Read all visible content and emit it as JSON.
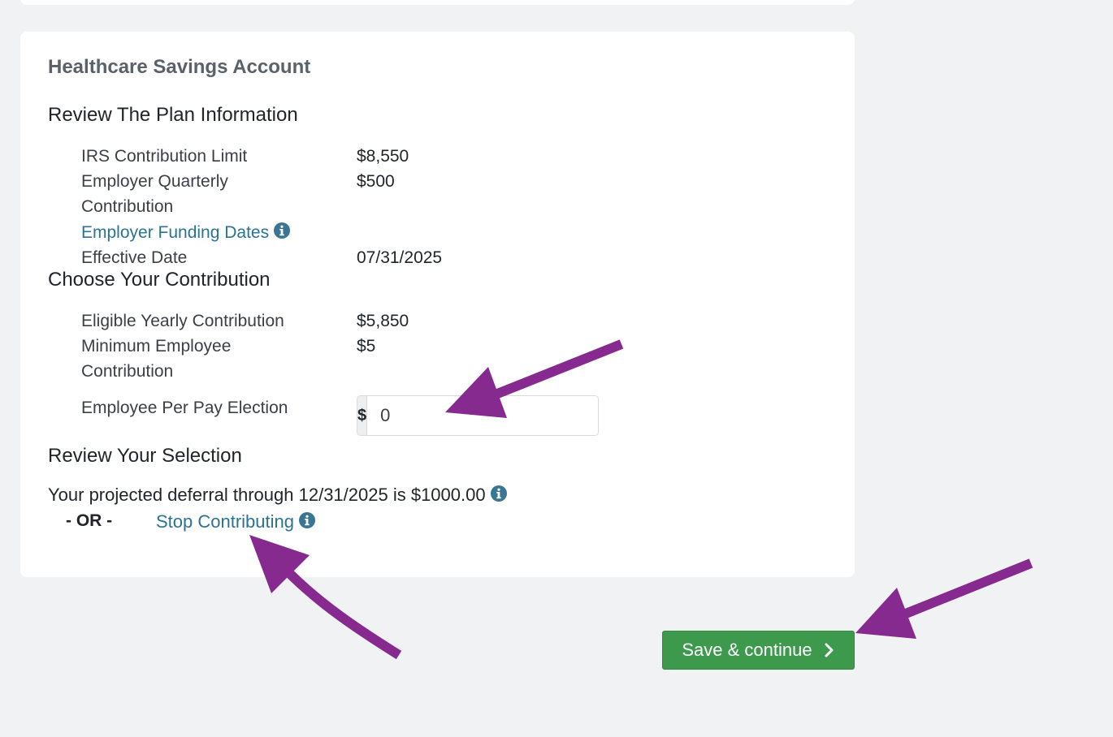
{
  "card": {
    "account_title": "Healthcare Savings Account",
    "review_plan": {
      "title": "Review The Plan Information",
      "irs_limit_label": "IRS Contribution Limit",
      "irs_limit_value": "$8,550",
      "employer_quarterly_label": "Employer Quarterly Contribution",
      "employer_quarterly_value": "$500",
      "funding_dates_link": "Employer Funding Dates",
      "effective_date_label": "Effective Date",
      "effective_date_value": "07/31/2025"
    },
    "choose_contribution": {
      "title": "Choose Your Contribution",
      "eligible_yearly_label": "Eligible Yearly Contribution",
      "eligible_yearly_value": "$5,850",
      "minimum_employee_label": "Minimum Employee Contribution",
      "minimum_employee_value": "$5",
      "per_pay_label": "Employee Per Pay Election",
      "per_pay_prefix": "$",
      "per_pay_value": "0"
    },
    "review_selection": {
      "title": "Review Your Selection",
      "projection_text": "Your projected deferral through 12/31/2025 is $1000.00",
      "or_label": "- OR -",
      "stop_link": "Stop Contributing"
    }
  },
  "footer": {
    "save_label": "Save & continue"
  },
  "icons": {
    "info": "info-circle-icon",
    "chevron": "chevron-right-icon"
  },
  "colors": {
    "link": "#2a7393",
    "primary_button": "#3d9a4d",
    "annotation_arrow": "#862a8f",
    "info_icon": "#3a7594"
  }
}
